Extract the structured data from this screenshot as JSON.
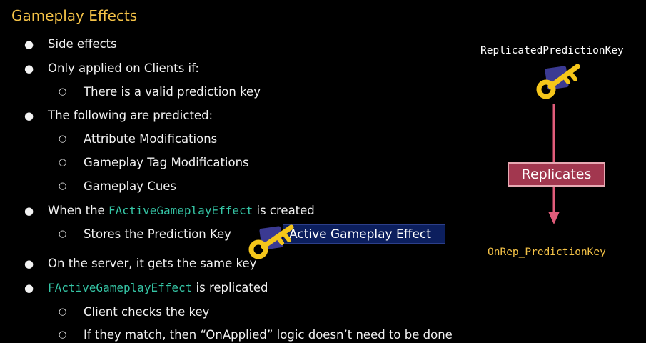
{
  "title": "Gameplay Effects",
  "bullets": [
    {
      "level": 1,
      "text": "Side effects"
    },
    {
      "level": 1,
      "text": "Only applied on Clients if:"
    },
    {
      "level": 2,
      "text": "There is a valid prediction key"
    },
    {
      "level": 1,
      "text": "The following are predicted:"
    },
    {
      "level": 2,
      "text": "Attribute Modifications"
    },
    {
      "level": 2,
      "text": "Gameplay Tag Modifications"
    },
    {
      "level": 2,
      "text": "Gameplay Cues"
    },
    {
      "level": 1,
      "pre": "When the ",
      "code": "FActiveGameplayEffect",
      "post": " is created"
    },
    {
      "level": 2,
      "text": "Stores the Prediction Key"
    },
    {
      "level": 1,
      "text": "On the server, it gets the same key"
    },
    {
      "level": 1,
      "pre": "",
      "code": "FActiveGameplayEffect",
      "post": " is replicated"
    },
    {
      "level": 2,
      "text": "Client checks the key"
    },
    {
      "level": 2,
      "text": "If they match, then “OnApplied” logic doesn’t need to be done"
    }
  ],
  "bullet_glyphs": {
    "level1": "●",
    "level2": "○"
  },
  "diagram": {
    "top_label": "ReplicatedPredictionKey",
    "arrow_label": "Replicates",
    "bottom_label": "OnRep_PredictionKey",
    "effect_box_label": "Active Gameplay Effect",
    "icons": [
      "key-icon",
      "down-arrow-icon"
    ]
  },
  "colors": {
    "title": "#f4c247",
    "code": "#35c6a6",
    "top_label": "#ffffff",
    "bottom_label": "#f4c247",
    "arrow": "#e05c7a",
    "key": "#f5c61a",
    "key_bg": "#3b3a92",
    "replicates_bg": "#a2374f",
    "effect_box_bg": "#0c1f5e"
  }
}
